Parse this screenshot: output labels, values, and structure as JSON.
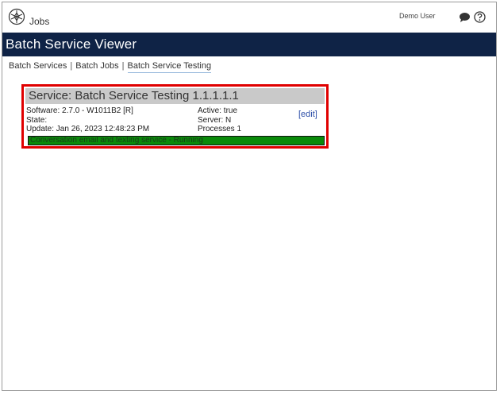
{
  "header": {
    "app_name": "Jobs",
    "user_name": "Demo User",
    "icons": [
      "logo-icon",
      "chat-icon",
      "help-icon"
    ]
  },
  "titlebar": {
    "title": "Batch Service Viewer"
  },
  "breadcrumb": {
    "items": [
      {
        "label": "Batch Services"
      },
      {
        "label": "Batch Jobs"
      },
      {
        "label": "Batch Service Testing"
      }
    ],
    "separator": "|"
  },
  "service_card": {
    "title": "Service: Batch Service Testing 1.1.1.1.1",
    "software": "Software: 2.7.0 - W1011B2 [R]",
    "state": "State:",
    "update": "Update: Jan 26, 2023 12:48:23 PM",
    "active": "Active: true",
    "server": "Server: N",
    "processes": "Processes 1",
    "edit_label": "[edit]",
    "status_text": "Conversation email and texting service - Running",
    "status_color": "#0a8a0a",
    "highlight_color": "#e00000"
  }
}
